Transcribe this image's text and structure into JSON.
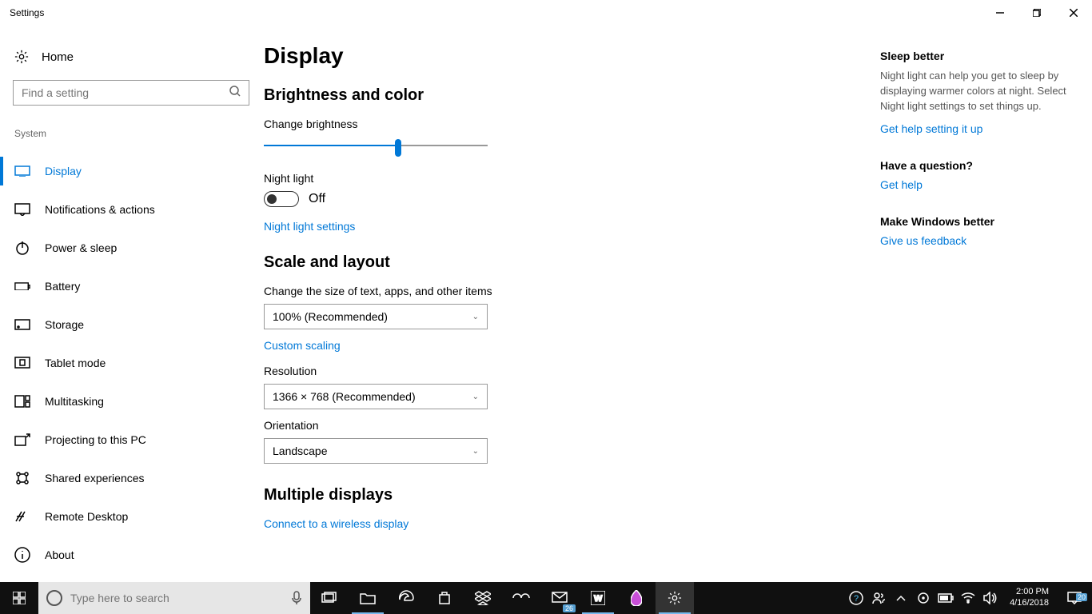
{
  "window": {
    "title": "Settings"
  },
  "sidebar": {
    "home": "Home",
    "search_placeholder": "Find a setting",
    "section": "System",
    "items": [
      {
        "label": "Display"
      },
      {
        "label": "Notifications & actions"
      },
      {
        "label": "Power & sleep"
      },
      {
        "label": "Battery"
      },
      {
        "label": "Storage"
      },
      {
        "label": "Tablet mode"
      },
      {
        "label": "Multitasking"
      },
      {
        "label": "Projecting to this PC"
      },
      {
        "label": "Shared experiences"
      },
      {
        "label": "Remote Desktop"
      },
      {
        "label": "About"
      }
    ]
  },
  "main": {
    "title": "Display",
    "brightness": {
      "section": "Brightness and color",
      "change_label": "Change brightness",
      "value_percent": 60,
      "night_light_label": "Night light",
      "night_light_state": "Off",
      "night_light_settings_link": "Night light settings"
    },
    "scale": {
      "section": "Scale and layout",
      "size_label": "Change the size of text, apps, and other items",
      "size_value": "100% (Recommended)",
      "custom_link": "Custom scaling",
      "resolution_label": "Resolution",
      "resolution_value": "1366 × 768 (Recommended)",
      "orientation_label": "Orientation",
      "orientation_value": "Landscape"
    },
    "multiple": {
      "section": "Multiple displays",
      "connect_link": "Connect to a wireless display"
    }
  },
  "right": {
    "sleep_heading": "Sleep better",
    "sleep_text": "Night light can help you get to sleep by displaying warmer colors at night. Select Night light settings to set things up.",
    "sleep_link": "Get help setting it up",
    "question_heading": "Have a question?",
    "question_link": "Get help",
    "feedback_heading": "Make Windows better",
    "feedback_link": "Give us feedback"
  },
  "taskbar": {
    "search_placeholder": "Type here to search",
    "mail_badge": "26",
    "clock_time": "2:00 PM",
    "clock_date": "4/16/2018",
    "action_badge": "20"
  }
}
